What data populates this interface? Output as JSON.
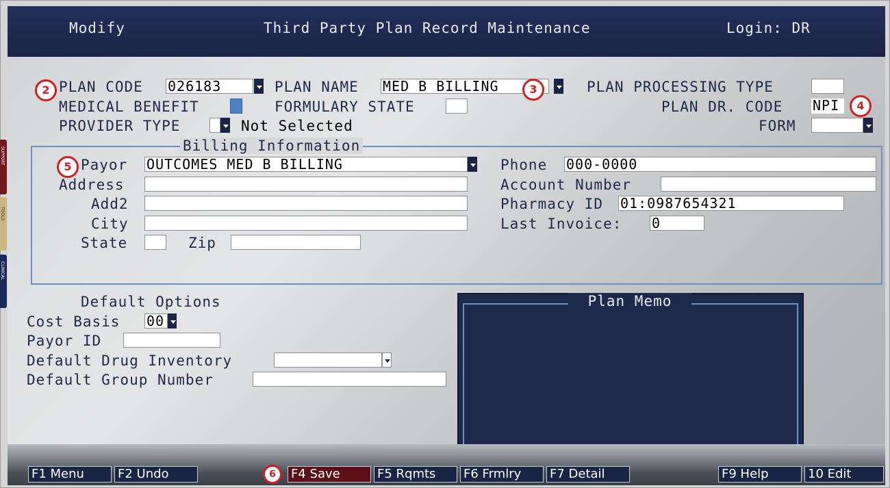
{
  "header": {
    "mode": "Modify",
    "title": "Third Party Plan Record Maintenance",
    "login": "Login: DR"
  },
  "side_tabs": [
    "SUPPORT",
    "TOOLS",
    "CLINICAL"
  ],
  "callouts": [
    "2",
    "3",
    "4",
    "5",
    "6"
  ],
  "plan": {
    "plan_code_label": "PLAN CODE",
    "plan_code_value": "026183",
    "plan_name_label": "PLAN NAME",
    "plan_name_value": "MED B BILLING",
    "processing_type_label": "PLAN PROCESSING TYPE",
    "processing_type_value": "",
    "medical_benefit_label": "MEDICAL BENEFIT",
    "formulary_state_label": "FORMULARY STATE",
    "formulary_state_value": "",
    "plan_dr_code_label": "PLAN DR. CODE",
    "plan_dr_code_value": "NPI",
    "provider_type_label": "PROVIDER TYPE",
    "provider_type_value": "",
    "provider_type_text": "Not Selected",
    "form_label": "FORM",
    "form_value": ""
  },
  "billing": {
    "title": "Billing Information",
    "payor_label": "Payor",
    "payor_value": "OUTCOMES MED B BILLING",
    "address_label": "Address",
    "address_value": "",
    "add2_label": "Add2",
    "add2_value": "",
    "city_label": "City",
    "city_value": "",
    "state_label": "State",
    "state_value": "",
    "zip_label": "Zip",
    "zip_value": "",
    "phone_label": "Phone",
    "phone_value": "000-0000",
    "account_label": "Account Number",
    "account_value": "",
    "pharmacy_label": "Pharmacy ID",
    "pharmacy_value": "01:0987654321",
    "invoice_label": "Last Invoice:",
    "invoice_value": "0"
  },
  "defaults": {
    "title": "Default Options",
    "cost_basis_label": "Cost Basis",
    "cost_basis_value": "00",
    "payor_id_label": "Payor ID",
    "payor_id_value": "",
    "drug_inventory_label": "Default Drug Inventory",
    "drug_inventory_value": "",
    "group_number_label": "Default Group Number",
    "group_number_value": ""
  },
  "memo": {
    "title": "Plan Memo"
  },
  "fkeys": [
    "F1 Menu",
    "F2 Undo",
    "F4 Save",
    "F5 Rqmts",
    "F6 Frmlry",
    "F7 Detail",
    "F9 Help",
    "10 Edit"
  ],
  "colors": {
    "header": "#1f2a4d",
    "accent_blue": "#6b8fc4",
    "save_key": "#5e1018",
    "callout": "#d22020"
  }
}
